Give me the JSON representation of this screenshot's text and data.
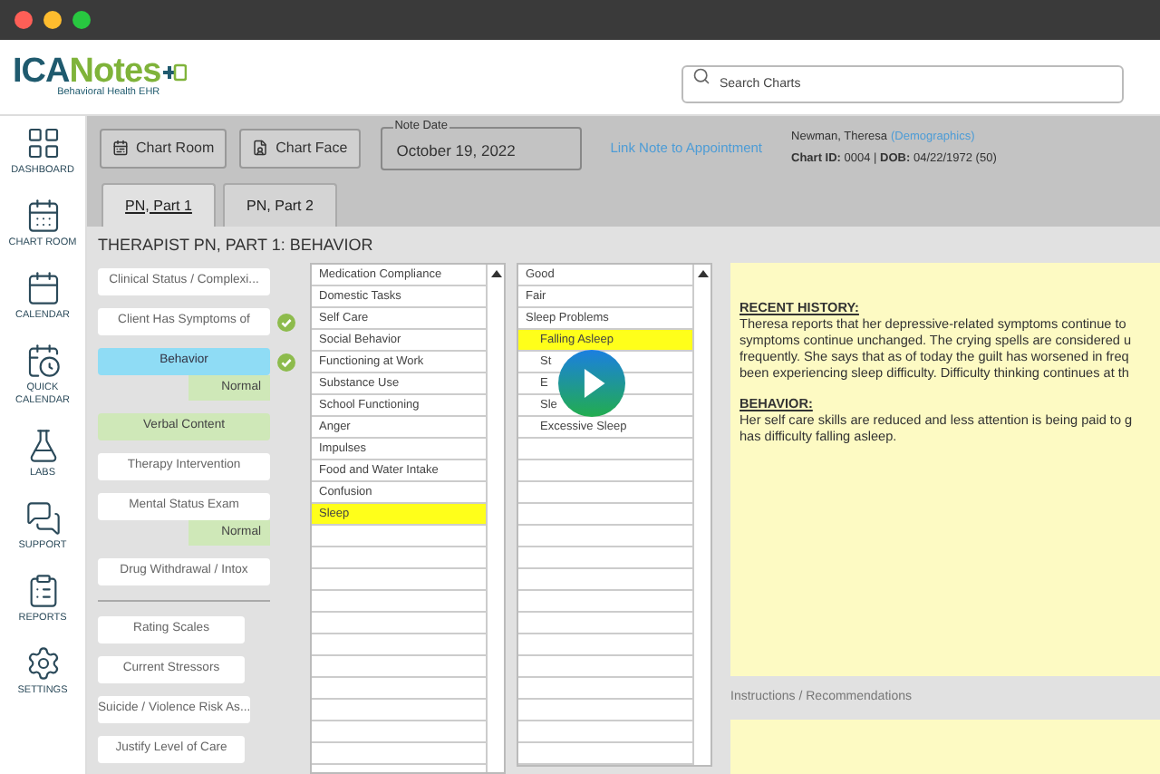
{
  "logo": {
    "prefix": "ICA",
    "name": "Notes",
    "tagline": "Behavioral Health EHR"
  },
  "search": {
    "placeholder": "Search Charts"
  },
  "sidebar": {
    "items": [
      {
        "label": "DASHBOARD",
        "kind": "dashboard"
      },
      {
        "label": "CHART ROOM",
        "kind": "chart"
      },
      {
        "label": "CALENDAR",
        "kind": "calendar"
      },
      {
        "label": "QUICK CALENDAR",
        "kind": "quick"
      },
      {
        "label": "LABS",
        "kind": "labs"
      },
      {
        "label": "SUPPORT",
        "kind": "support"
      },
      {
        "label": "REPORTS",
        "kind": "reports"
      },
      {
        "label": "SETTINGS",
        "kind": "settings"
      }
    ]
  },
  "toolbar": {
    "buttons": [
      {
        "label": "Chart Room",
        "kind": "room"
      },
      {
        "label": "Chart Face",
        "kind": "face"
      }
    ],
    "note_date": {
      "label": "Note Date",
      "value": "October 19, 2022"
    },
    "link": "Link Note to Appointment",
    "patient": {
      "name": "Newman, Theresa",
      "link": "(Demographics)",
      "details": "**Chart ID:** 0004 | **DOB:** 04/22/1972 (50)"
    }
  },
  "tabs": [
    {
      "label": "PN, Part 1",
      "selected": true
    },
    {
      "label": "PN, Part 2",
      "selected": false
    }
  ],
  "section_title": "THERAPIST PN, PART 1: BEHAVIOR",
  "left_panel": {
    "groups": [
      [
        {
          "label": "Clinical Status / Complexi...",
          "selected": false,
          "visited": false,
          "checked": false
        },
        {
          "label": "Client Has Symptoms of",
          "selected": false,
          "visited": false,
          "checked": true
        },
        {
          "label": "Behavior",
          "selected": true,
          "visited": false,
          "checked": true,
          "tag": "Normal"
        },
        {
          "label": "Verbal Content",
          "selected": false,
          "visited": true,
          "checked": false
        },
        {
          "label": "Therapy Intervention",
          "selected": false,
          "visited": false,
          "checked": false
        },
        {
          "label": "Mental Status Exam",
          "selected": false,
          "visited": false,
          "checked": false,
          "tag": "Normal"
        },
        {
          "label": "Drug Withdrawal / Intox",
          "selected": false,
          "visited": false,
          "checked": false
        }
      ],
      [
        {
          "label": "Rating Scales",
          "selected": false,
          "visited": false,
          "checked": false
        },
        {
          "label": "Current Stressors",
          "selected": false,
          "visited": false,
          "checked": false
        },
        {
          "label": "Suicide / Violence Risk As...",
          "selected": false,
          "visited": false,
          "checked": false
        },
        {
          "label": "Justify Level of Care",
          "selected": false,
          "visited": false,
          "checked": false
        }
      ]
    ]
  },
  "list_1": [
    {
      "label": "Medication Compliance",
      "selected": false
    },
    {
      "label": "Domestic Tasks",
      "selected": false
    },
    {
      "label": "Self Care",
      "selected": false
    },
    {
      "label": "Social Behavior",
      "selected": false
    },
    {
      "label": "Functioning at Work",
      "selected": false
    },
    {
      "label": "Substance Use",
      "selected": false
    },
    {
      "label": "School Functioning",
      "selected": false
    },
    {
      "label": "Anger",
      "selected": false
    },
    {
      "label": "Impulses",
      "selected": false
    },
    {
      "label": "Food and Water Intake",
      "selected": false
    },
    {
      "label": "Confusion",
      "selected": false
    },
    {
      "label": "Sleep",
      "selected": true
    }
  ],
  "list_2": [
    {
      "label": "Good",
      "selected": false
    },
    {
      "label": "Fair",
      "selected": false
    },
    {
      "label": "Sleep Problems",
      "selected": false,
      "children": [
        {
          "label": "Falling Asleep",
          "selected": true
        },
        {
          "label": "St",
          "selected": false
        },
        {
          "label": "E",
          "selected": false
        },
        {
          "label": "Sle",
          "selected": false
        },
        {
          "label": "Excessive Sleep",
          "selected": false
        }
      ]
    }
  ],
  "note": {
    "sections": [
      {
        "heading": "RECENT HISTORY:",
        "lines": [
          "Theresa reports that her depressive-related symptoms continue to",
          "symptoms continue unchanged. The crying spells are considered u",
          "frequently. She says that as of today the guilt has worsened in freq",
          "been experiencing sleep difficulty. Difficulty thinking continues at th"
        ]
      },
      {
        "heading": "BEHAVIOR:",
        "lines": [
          "Her self care skills are reduced and less attention is being paid to g",
          "has difficulty falling asleep."
        ]
      }
    ]
  },
  "instructions_label": "Instructions / Recommendations"
}
